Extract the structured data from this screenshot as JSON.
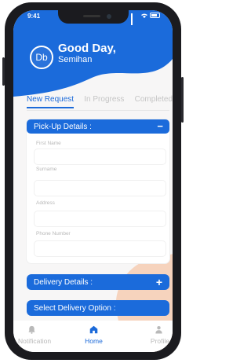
{
  "status_bar": {
    "time": "9:41"
  },
  "header": {
    "avatar_initials": "Db",
    "greeting": "Good Day,",
    "user_name": "Semihan"
  },
  "tabs": [
    {
      "label": "New Request",
      "active": true
    },
    {
      "label": "In Progress",
      "active": false
    },
    {
      "label": "Completed",
      "active": false
    }
  ],
  "pickup": {
    "title": "Pick-Up Details :",
    "toggle_symbol": "−",
    "fields": [
      {
        "label": "First Name",
        "value": ""
      },
      {
        "label": "Surname",
        "value": ""
      },
      {
        "label": "Address",
        "value": ""
      },
      {
        "label": "Phone Number",
        "value": ""
      }
    ]
  },
  "delivery": {
    "title": "Delivery Details :",
    "toggle_symbol": "+"
  },
  "delivery_option": {
    "title": "Select Delivery Option :"
  },
  "bottom_nav": [
    {
      "label": "Notification",
      "icon": "bell-icon",
      "active": false
    },
    {
      "label": "Home",
      "icon": "home-icon",
      "active": true
    },
    {
      "label": "Profile",
      "icon": "profile-icon",
      "active": false
    }
  ],
  "colors": {
    "primary": "#1b6bdb",
    "background": "#f7f6f6",
    "accent_shape": "#f6d3bd"
  }
}
